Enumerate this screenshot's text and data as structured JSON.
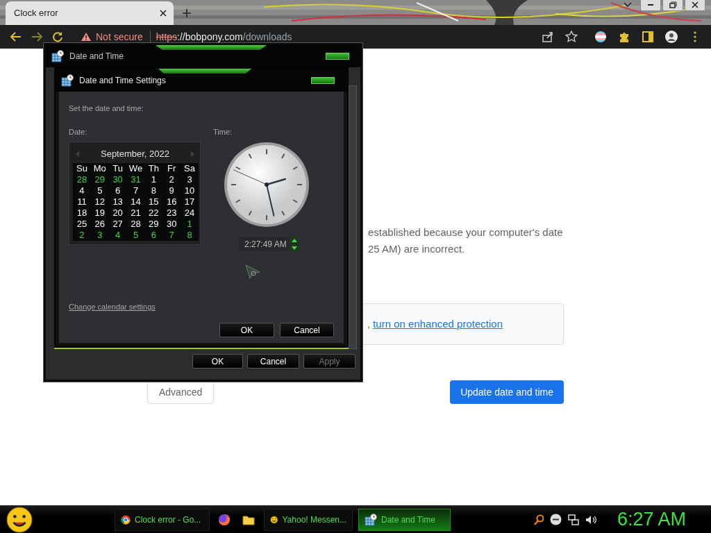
{
  "browser": {
    "tab": {
      "title": "Clock error",
      "selected": true
    },
    "toolbar": {
      "security_label": "Not secure",
      "insecure": true,
      "url": {
        "scheme": "https",
        "host": "://bobpony.com",
        "path": "/downloads"
      }
    }
  },
  "page": {
    "message_lines": [
      "established because your computer's date",
      "25 AM) are incorrect."
    ],
    "protection_box": {
      "lead": ",",
      "link": "turn on enhanced protection"
    },
    "buttons": [
      {
        "label": "Advanced",
        "kind": "secondary"
      },
      {
        "label": "Update date and time",
        "kind": "primary"
      }
    ]
  },
  "dialog": {
    "title": "Date and Time",
    "buttons": [
      {
        "label": "OK",
        "disabled": false
      },
      {
        "label": "Cancel",
        "disabled": false
      },
      {
        "label": "Apply",
        "disabled": true
      }
    ],
    "settings": {
      "title": "Date and Time Settings",
      "instruction": "Set the date and time:",
      "date_label": "Date:",
      "time_label": "Time:",
      "calendar": {
        "month": "September, 2022",
        "weekdays": [
          "Su",
          "Mo",
          "Tu",
          "We",
          "Th",
          "Fr",
          "Sa"
        ],
        "weeks": [
          [
            {
              "day": "28",
              "other_month": true
            },
            {
              "day": "29",
              "other_month": true
            },
            {
              "day": "30",
              "other_month": true
            },
            {
              "day": "31",
              "other_month": true
            },
            {
              "day": "1",
              "other_month": false
            },
            {
              "day": "2",
              "other_month": false
            },
            {
              "day": "3",
              "other_month": false
            }
          ],
          [
            {
              "day": "4",
              "other_month": false
            },
            {
              "day": "5",
              "other_month": false
            },
            {
              "day": "6",
              "other_month": false
            },
            {
              "day": "7",
              "other_month": false
            },
            {
              "day": "8",
              "other_month": false
            },
            {
              "day": "9",
              "other_month": false
            },
            {
              "day": "10",
              "other_month": false
            }
          ],
          [
            {
              "day": "11",
              "other_month": false
            },
            {
              "day": "12",
              "other_month": false
            },
            {
              "day": "13",
              "other_month": false
            },
            {
              "day": "14",
              "other_month": false
            },
            {
              "day": "15",
              "other_month": false
            },
            {
              "day": "16",
              "other_month": false
            },
            {
              "day": "17",
              "other_month": false
            }
          ],
          [
            {
              "day": "18",
              "other_month": false
            },
            {
              "day": "19",
              "other_month": false
            },
            {
              "day": "20",
              "other_month": false
            },
            {
              "day": "21",
              "other_month": false
            },
            {
              "day": "22",
              "other_month": false
            },
            {
              "day": "23",
              "other_month": false
            },
            {
              "day": "24",
              "other_month": false
            }
          ],
          [
            {
              "day": "25",
              "other_month": false
            },
            {
              "day": "26",
              "other_month": false
            },
            {
              "day": "27",
              "other_month": false
            },
            {
              "day": "28",
              "other_month": false
            },
            {
              "day": "29",
              "other_month": false
            },
            {
              "day": "30",
              "other_month": false
            },
            {
              "day": "1",
              "other_month": true
            }
          ],
          [
            {
              "day": "2",
              "other_month": true
            },
            {
              "day": "3",
              "other_month": true
            },
            {
              "day": "4",
              "other_month": true
            },
            {
              "day": "5",
              "other_month": true
            },
            {
              "day": "6",
              "other_month": true
            },
            {
              "day": "7",
              "other_month": true
            },
            {
              "day": "8",
              "other_month": true
            }
          ]
        ]
      },
      "time_value": "2:27:49 AM",
      "link": "Change calendar settings",
      "buttons": [
        {
          "label": "OK"
        },
        {
          "label": "Cancel"
        }
      ]
    }
  },
  "taskbar": {
    "items": [
      {
        "kind": "browser",
        "label": "Clock error - Go...",
        "selected": false
      },
      {
        "kind": "firefox",
        "selected": false
      },
      {
        "kind": "folder",
        "selected": false
      },
      {
        "kind": "messenger",
        "label": "Yahoo! Messen...",
        "selected": false
      },
      {
        "kind": "datetime",
        "label": "Date and Time",
        "selected": true
      }
    ],
    "clock": "6:27 AM"
  }
}
